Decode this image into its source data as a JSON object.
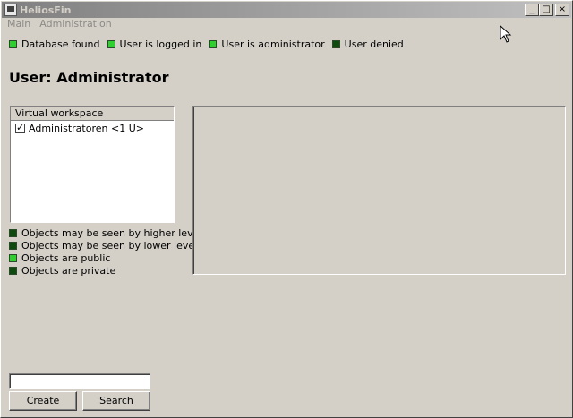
{
  "window": {
    "title": "HeliosFin"
  },
  "caption_buttons": {
    "minimize": "_",
    "maximize": "□",
    "close": "×"
  },
  "menu": [
    {
      "label": "Main"
    },
    {
      "label": "Administration"
    }
  ],
  "status_legend": [
    {
      "label": "Database found",
      "state": "light",
      "color": "#2fcf2f"
    },
    {
      "label": "User is logged in",
      "state": "light",
      "color": "#2fcf2f"
    },
    {
      "label": "User is administrator",
      "state": "light",
      "color": "#2fcf2f"
    },
    {
      "label": "User denied",
      "state": "dark",
      "color": "#0f4a0f"
    }
  ],
  "user_title": "User: Administrator",
  "workspace": {
    "header": "Virtual workspace",
    "items": [
      {
        "label": "Administratoren <1 U>",
        "checked": true
      }
    ]
  },
  "visibility_legend": [
    {
      "label": "Objects may be seen by higher levels",
      "state": "dark"
    },
    {
      "label": "Objects may be seen by lower levels",
      "state": "dark"
    },
    {
      "label": "Objects are public",
      "state": "light"
    },
    {
      "label": "Objects are private",
      "state": "dark"
    }
  ],
  "search": {
    "value": "",
    "placeholder": ""
  },
  "buttons": {
    "create": "Create",
    "search": "Search"
  }
}
